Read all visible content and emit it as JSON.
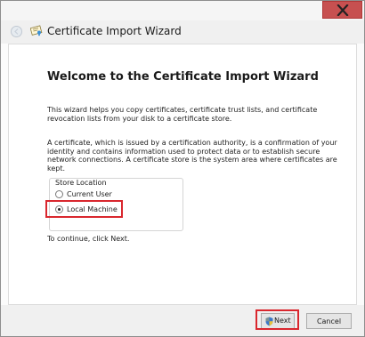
{
  "window": {
    "title": "Certificate Import Wizard",
    "close_symbol": "✕"
  },
  "wizard": {
    "heading": "Welcome to the Certificate Import Wizard",
    "para1": "This wizard helps you copy certificates, certificate trust lists, and certificate revocation lists from your disk to a certificate store.",
    "para2": "A certificate, which is issued by a certification authority, is a confirmation of your identity and contains information used to protect data or to establish secure network connections. A certificate store is the system area where certificates are kept.",
    "store_location": {
      "legend": "Store Location",
      "options": [
        {
          "label": "Current User",
          "selected": false
        },
        {
          "label": "Local Machine",
          "selected": true
        }
      ]
    },
    "continue_text": "To continue, click Next."
  },
  "buttons": {
    "next": "Next",
    "cancel": "Cancel"
  },
  "colors": {
    "highlight": "#d9272e",
    "close_button": "#c75050"
  },
  "icons": [
    "close-icon",
    "back-arrow-icon",
    "certificate-icon",
    "uac-shield-icon"
  ]
}
